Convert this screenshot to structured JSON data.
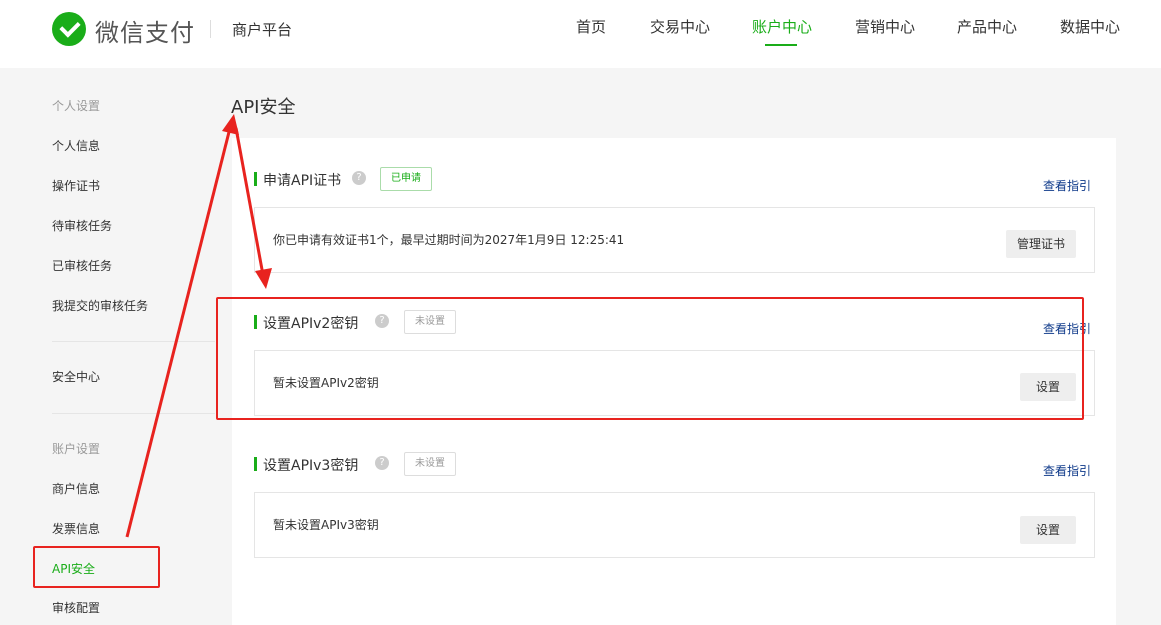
{
  "header": {
    "brand": "微信支付",
    "subtitle": "商户平台",
    "nav": [
      "首页",
      "交易中心",
      "账户中心",
      "营销中心",
      "产品中心",
      "数据中心"
    ],
    "active_nav": "账户中心"
  },
  "sidebar": {
    "groups": [
      {
        "title": "个人设置",
        "items": [
          "个人信息",
          "操作证书",
          "待审核任务",
          "已审核任务",
          "我提交的审核任务"
        ]
      },
      {
        "title": "",
        "items": [
          "安全中心"
        ]
      },
      {
        "title": "账户设置",
        "items": [
          "商户信息",
          "发票信息",
          "API安全",
          "审核配置"
        ]
      }
    ],
    "active_item": "API安全"
  },
  "main": {
    "title": "API安全",
    "help_icon_char": "?",
    "sections": [
      {
        "title": "申请API证书",
        "status": "已申请",
        "guide": "查看指引",
        "message": "你已申请有效证书1个，最早过期时间为2027年1月9日 12:25:41",
        "button": "管理证书"
      },
      {
        "title": "设置APIv2密钥",
        "status": "未设置",
        "guide": "查看指引",
        "message": "暂未设置APIv2密钥",
        "button": "设置"
      },
      {
        "title": "设置APIv3密钥",
        "status": "未设置",
        "guide": "查看指引",
        "message": "暂未设置APIv3密钥",
        "button": "设置"
      }
    ]
  },
  "colors": {
    "accent": "#1aad19",
    "annotation": "#e8231f",
    "link": "#0f3a8a"
  }
}
